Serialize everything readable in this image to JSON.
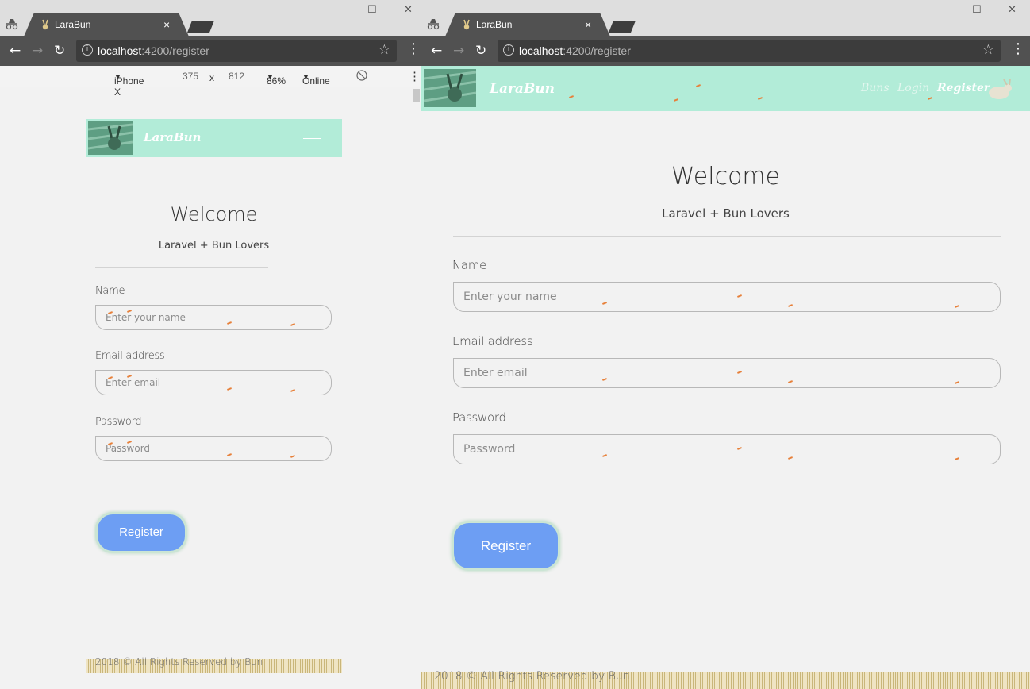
{
  "browser": {
    "tab_title": "LaraBun",
    "tab_close": "×",
    "url_host": "localhost",
    "url_rest": ":4200/register",
    "window_controls": {
      "minimize": "—",
      "maximize": "☐",
      "close": "✕"
    },
    "nav": {
      "back": "←",
      "forward": "→",
      "reload": "↻",
      "star": "☆",
      "menu": "⋮",
      "info": "i"
    }
  },
  "devtools": {
    "device": "iPhone X",
    "width": "375",
    "times": "x",
    "height": "812",
    "zoom": "86%",
    "network": "Online",
    "caret": "▼",
    "menu": "⋮"
  },
  "site": {
    "brand": "LaraBun",
    "nav_links": [
      "Buns",
      "Login",
      "Register"
    ],
    "welcome": "Welcome",
    "subtitle": "Laravel + Bun Lovers",
    "form": {
      "name_label": "Name",
      "name_placeholder": "Enter your name",
      "email_label": "Email address",
      "email_placeholder": "Enter email",
      "password_label": "Password",
      "password_placeholder": "Password",
      "submit_label": "Register"
    },
    "footer": "2018 © All Rights Reserved by Bun"
  },
  "colors": {
    "navbar": "#b2ecd8",
    "button": "#6d9ef3",
    "chrome_dark": "#515151",
    "carrot": "#e7803a"
  }
}
